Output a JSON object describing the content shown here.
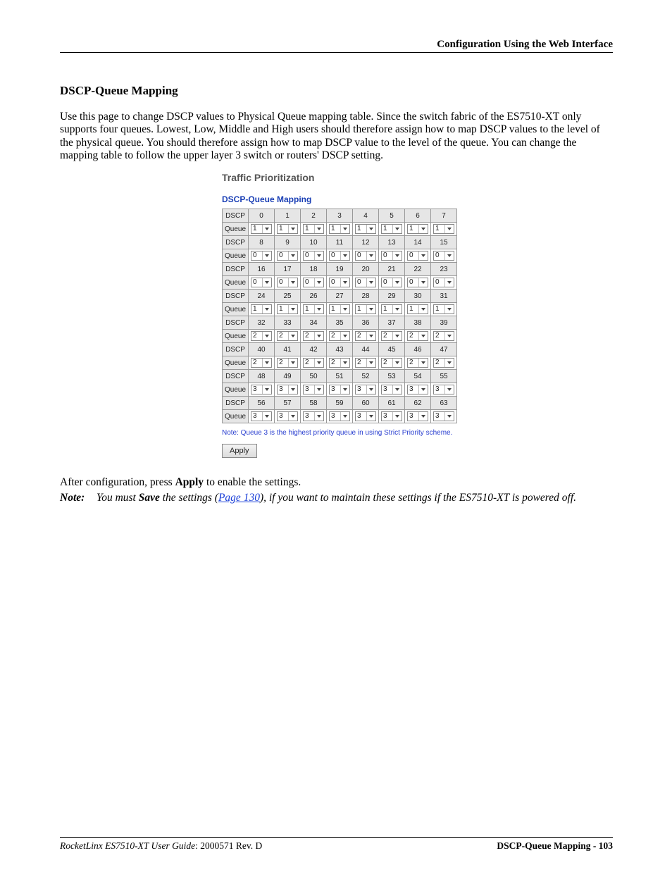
{
  "header": {
    "right": "Configuration Using the Web Interface"
  },
  "section": {
    "title": "DSCP-Queue Mapping"
  },
  "intro": "Use this page to change DSCP values to Physical Queue mapping table. Since the switch fabric of the ES7510-XT only supports four queues. Lowest, Low, Middle and High users should therefore assign how to map DSCP values to the level of the physical queue. You should therefore assign how to map DSCP value to the level of the queue. You can change the mapping table to follow the upper layer 3 switch or routers' DSCP setting.",
  "screenshot": {
    "title": "Traffic Prioritization",
    "subtitle": "DSCP-Queue Mapping",
    "row_label_dscp": "DSCP",
    "row_label_queue": "Queue",
    "groups": [
      {
        "dscp": [
          0,
          1,
          2,
          3,
          4,
          5,
          6,
          7
        ],
        "queue": [
          1,
          1,
          1,
          1,
          1,
          1,
          1,
          1
        ]
      },
      {
        "dscp": [
          8,
          9,
          10,
          11,
          12,
          13,
          14,
          15
        ],
        "queue": [
          0,
          0,
          0,
          0,
          0,
          0,
          0,
          0
        ]
      },
      {
        "dscp": [
          16,
          17,
          18,
          19,
          20,
          21,
          22,
          23
        ],
        "queue": [
          0,
          0,
          0,
          0,
          0,
          0,
          0,
          0
        ]
      },
      {
        "dscp": [
          24,
          25,
          26,
          27,
          28,
          29,
          30,
          31
        ],
        "queue": [
          1,
          1,
          1,
          1,
          1,
          1,
          1,
          1
        ]
      },
      {
        "dscp": [
          32,
          33,
          34,
          35,
          36,
          37,
          38,
          39
        ],
        "queue": [
          2,
          2,
          2,
          2,
          2,
          2,
          2,
          2
        ]
      },
      {
        "dscp": [
          40,
          41,
          42,
          43,
          44,
          45,
          46,
          47
        ],
        "queue": [
          2,
          2,
          2,
          2,
          2,
          2,
          2,
          2
        ]
      },
      {
        "dscp": [
          48,
          49,
          50,
          51,
          52,
          53,
          54,
          55
        ],
        "queue": [
          3,
          3,
          3,
          3,
          3,
          3,
          3,
          3
        ]
      },
      {
        "dscp": [
          56,
          57,
          58,
          59,
          60,
          61,
          62,
          63
        ],
        "queue": [
          3,
          3,
          3,
          3,
          3,
          3,
          3,
          3
        ]
      }
    ],
    "note": "Note: Queue 3 is the highest priority queue in using Strict Priority scheme.",
    "apply": "Apply"
  },
  "after": {
    "line": "After configuration, press Apply to enable the settings.",
    "bold_word": "Apply"
  },
  "note": {
    "label": "Note:",
    "pre": "You must ",
    "save": "Save",
    "mid": " the settings (",
    "link": "Page 130",
    "post": "), if you want to maintain these settings if the ES7510-XT is powered off."
  },
  "footer": {
    "left_italic": "RocketLinx ES7510-XT  User Guide",
    "left_rest": ": 2000571 Rev. D",
    "right": "DSCP-Queue Mapping - 103"
  }
}
